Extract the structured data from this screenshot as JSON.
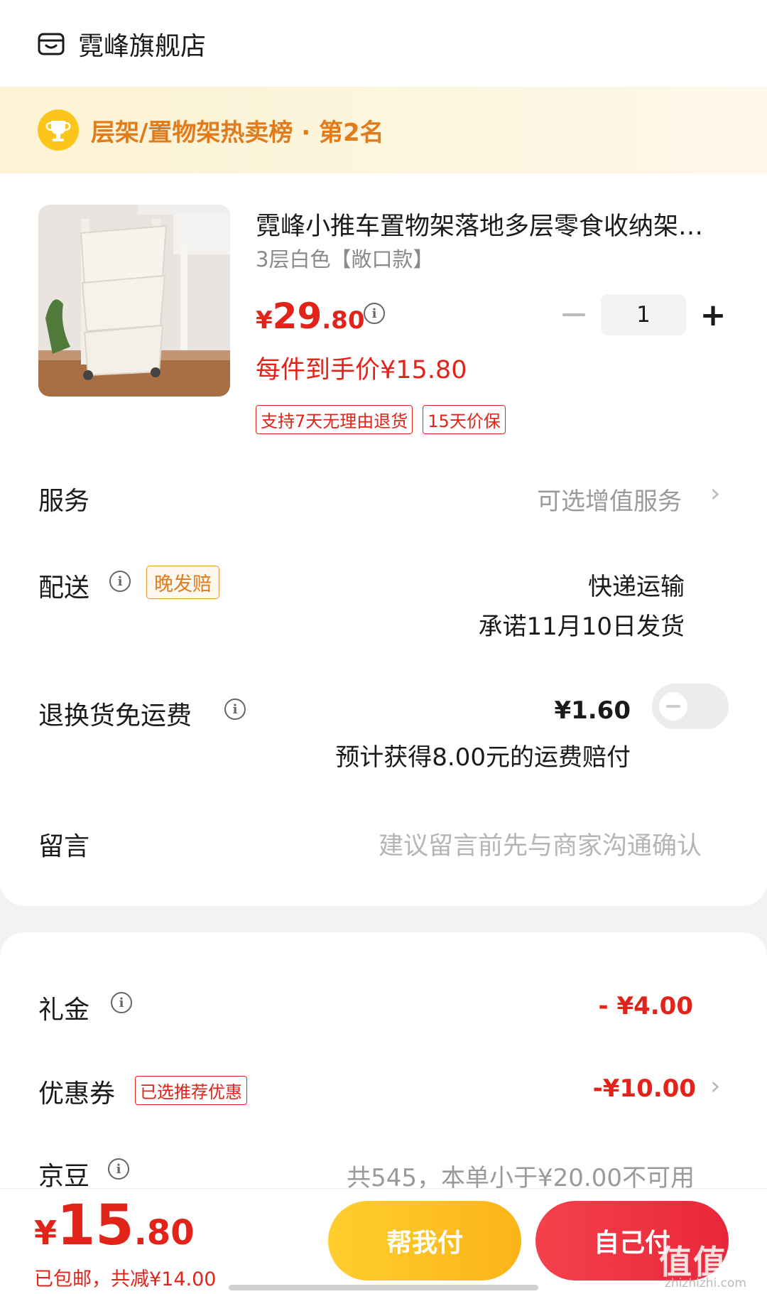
{
  "store": {
    "name": "霓峰旗舰店",
    "icon": "store-icon"
  },
  "rank_banner": {
    "text": "层架/置物架热卖榜 · 第2名",
    "icon": "trophy-icon"
  },
  "product": {
    "title": "霓峰小推车置物架落地多层零食收纳架客厅厨房卫生间",
    "spec": "3层白色【敞口款】",
    "price_symbol": "¥",
    "price_int": "29",
    "price_dec": ".80",
    "quantity": "1",
    "final_price": "每件到手价¥15.80",
    "tags": [
      "支持7天无理由退货",
      "15天价保"
    ]
  },
  "service": {
    "label": "服务",
    "value": "可选增值服务"
  },
  "delivery": {
    "label": "配送",
    "tag": "晚发赔",
    "method": "快递运输",
    "promise": "承诺11月10日发货"
  },
  "return_shipping": {
    "label": "退换货免运费",
    "price": "¥1.60",
    "note": "预计获得8.00元的运费赔付",
    "toggle_on": false
  },
  "message": {
    "label": "留言",
    "placeholder": "建议留言前先与商家沟通确认"
  },
  "gift": {
    "label": "礼金",
    "value": "- ¥4.00"
  },
  "coupon": {
    "label": "优惠券",
    "tag": "已选推荐优惠",
    "value": "-¥10.00"
  },
  "jingdou": {
    "label": "京豆",
    "value": "共545，本单小于¥20.00不可用"
  },
  "bottom": {
    "total_symbol": "¥",
    "total_int": "15",
    "total_dec": ".80",
    "summary": "已包邮，共减¥14.00",
    "help_pay": "帮我付",
    "self_pay": "自己付",
    "watermark": "值值值",
    "watermark_sub": "zhizhizhi.com"
  },
  "colors": {
    "accent_red": "#e2231a",
    "banner_orange": "#e27b1a",
    "help_yellow": "#fbb418",
    "pay_red": "#e8273a"
  }
}
